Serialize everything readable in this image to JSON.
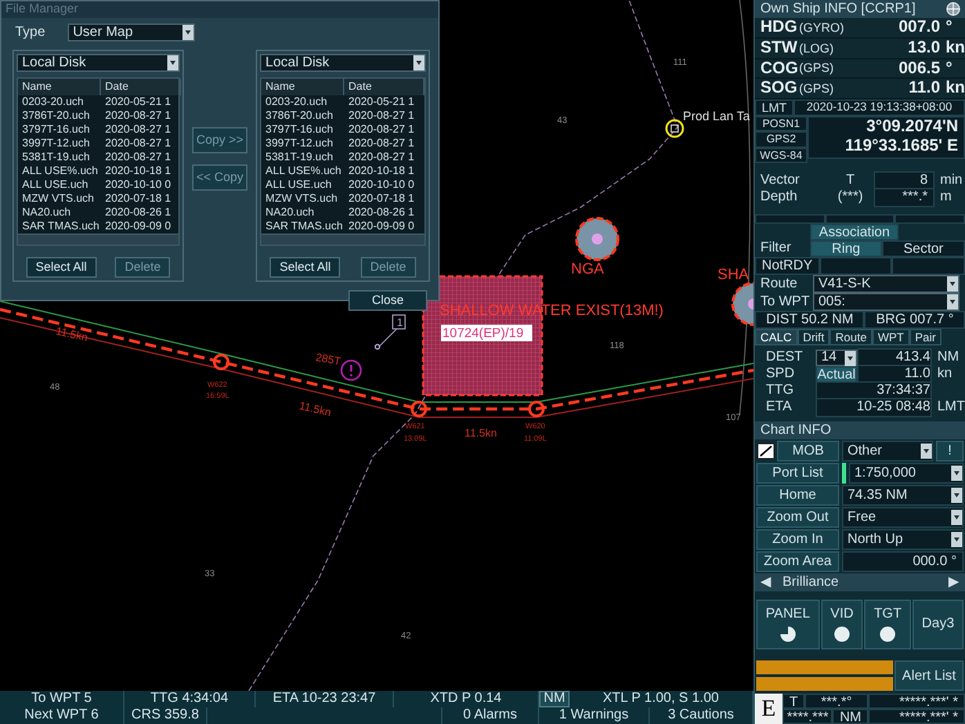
{
  "file_manager": {
    "title": "File Manager",
    "type_label": "Type",
    "type_value": "User Map",
    "panes": [
      {
        "source": "Local Disk",
        "columns": [
          "Name",
          "Date"
        ],
        "rows": [
          {
            "name": "0203-20.uch",
            "date": "2020-05-21 1"
          },
          {
            "name": "3786T-20.uch",
            "date": "2020-08-27 1"
          },
          {
            "name": "3797T-16.uch",
            "date": "2020-08-27 1"
          },
          {
            "name": "3997T-12.uch",
            "date": "2020-08-27 1"
          },
          {
            "name": "5381T-19.uch",
            "date": "2020-08-27 1"
          },
          {
            "name": "ALL USE%.uch",
            "date": "2020-10-18 1"
          },
          {
            "name": "ALL USE.uch",
            "date": "2020-10-10 0"
          },
          {
            "name": "MZW VTS.uch",
            "date": "2020-07-18 1"
          },
          {
            "name": "NA20.uch",
            "date": "2020-08-26 1"
          },
          {
            "name": "SAR TMAS.uch",
            "date": "2020-09-09 0"
          }
        ],
        "buttons": [
          {
            "label": "Select All",
            "disabled": false
          },
          {
            "label": "Delete",
            "disabled": true
          }
        ]
      },
      {
        "source": "Local Disk",
        "columns": [
          "Name",
          "Date"
        ],
        "rows": [
          {
            "name": "0203-20.uch",
            "date": "2020-05-21 1"
          },
          {
            "name": "3786T-20.uch",
            "date": "2020-08-27 1"
          },
          {
            "name": "3797T-16.uch",
            "date": "2020-08-27 1"
          },
          {
            "name": "3997T-12.uch",
            "date": "2020-08-27 1"
          },
          {
            "name": "5381T-19.uch",
            "date": "2020-08-27 1"
          },
          {
            "name": "ALL USE%.uch",
            "date": "2020-10-18 1"
          },
          {
            "name": "ALL USE.uch",
            "date": "2020-10-10 0"
          },
          {
            "name": "MZW VTS.uch",
            "date": "2020-07-18 1"
          },
          {
            "name": "NA20.uch",
            "date": "2020-08-26 1"
          },
          {
            "name": "SAR TMAS.uch",
            "date": "2020-09-09 0"
          }
        ],
        "buttons": [
          {
            "label": "Select All",
            "disabled": false
          },
          {
            "label": "Delete",
            "disabled": true
          }
        ]
      }
    ],
    "copy_buttons": [
      {
        "label": "Copy >>",
        "disabled": true
      },
      {
        "label": "<< Copy",
        "disabled": true
      }
    ],
    "close": "Close"
  },
  "chart": {
    "labels": [
      {
        "text": "Prod Lan Ta",
        "kind": "name"
      },
      {
        "text": "NGA",
        "kind": "warning"
      },
      {
        "text": "SHA",
        "kind": "warning"
      },
      {
        "text": "SHALLOW WATER EXIST(13M!)",
        "kind": "warning"
      },
      {
        "text": "10724(EP)/19",
        "kind": "tag"
      },
      {
        "text": "11.5kn",
        "kind": "speed"
      },
      {
        "text": "11.5kn",
        "kind": "speed"
      },
      {
        "text": "11.5kn",
        "kind": "speed"
      },
      {
        "text": "285T",
        "kind": "speed"
      },
      {
        "text": "W622",
        "kind": "waypoint"
      },
      {
        "text": "16:59L",
        "kind": "waypoint"
      },
      {
        "text": "W621",
        "kind": "waypoint"
      },
      {
        "text": "13:09L",
        "kind": "waypoint"
      },
      {
        "text": "W620",
        "kind": "waypoint"
      },
      {
        "text": "11:09L",
        "kind": "waypoint"
      },
      {
        "text": "1",
        "kind": "mark"
      },
      {
        "text": "43",
        "kind": "depth"
      },
      {
        "text": "111",
        "kind": "depth"
      },
      {
        "text": "118",
        "kind": "depth"
      },
      {
        "text": "107",
        "kind": "depth"
      },
      {
        "text": "48",
        "kind": "depth"
      },
      {
        "text": "33",
        "kind": "depth"
      },
      {
        "text": "42",
        "kind": "depth"
      }
    ]
  },
  "status_bar": {
    "to_wpt": "To WPT 5",
    "ttg": "TTG 4:34:04",
    "eta": "ETA 10-23 23:47",
    "xtd": "XTD P 0.14",
    "xtd_unit": "NM",
    "xtl": "XTL P 1.00, S 1.00",
    "next_wpt": "Next WPT 6",
    "crs": "CRS 359.8",
    "alarms": "0 Alarms",
    "warnings": "1 Warnings",
    "cautions": "3 Cautions"
  },
  "own_ship": {
    "title": "Own Ship INFO [CCRP1]",
    "readings": [
      {
        "name": "HDG",
        "source": "(GYRO)",
        "value": "007.0",
        "unit": "°"
      },
      {
        "name": "STW",
        "source": "(LOG)",
        "value": "13.0",
        "unit": "kn"
      },
      {
        "name": "COG",
        "source": "(GPS)",
        "value": "006.5",
        "unit": "°"
      },
      {
        "name": "SOG",
        "source": "(GPS)",
        "value": "11.0",
        "unit": "kn"
      }
    ],
    "lmt_label": "LMT",
    "lmt": "2020-10-23 19:13:38+08:00",
    "position": {
      "labels": [
        "POSN1",
        "GPS2",
        "WGS-84"
      ],
      "lat": "3°09.2074'N",
      "lon": "119°33.1685' E"
    },
    "vector": {
      "label": "Vector",
      "mode": "T",
      "value": "8",
      "unit": "min"
    },
    "depth": {
      "label": "Depth",
      "source": "(***)",
      "value": "***.*",
      "unit": "m"
    },
    "filter": {
      "label": "Filter",
      "options": [
        {
          "label": "Association",
          "selected": true
        },
        {
          "label": "Ring",
          "selected": true
        },
        {
          "label": "Sector",
          "selected": false
        }
      ],
      "status": "NotRDY"
    }
  },
  "route": {
    "route_label": "Route",
    "route": "V41-S-K",
    "wpt_label": "To WPT",
    "wpt": "005:",
    "dist": "DIST 50.2 NM",
    "brg": "BRG 007.7 °",
    "tabs": [
      {
        "label": "CALC",
        "selected": true
      },
      {
        "label": "Drift",
        "selected": false
      },
      {
        "label": "Route",
        "selected": false
      },
      {
        "label": "WPT",
        "selected": false
      },
      {
        "label": "Pair",
        "selected": false
      }
    ],
    "calc": [
      {
        "label": "DEST",
        "kind": "select",
        "control": "14",
        "value": "413.4",
        "unit": "NM"
      },
      {
        "label": "SPD",
        "kind": "button",
        "control": "Actual",
        "value": "11.0",
        "unit": "kn"
      },
      {
        "label": "TTG",
        "kind": "plain",
        "value": "37:34:37"
      },
      {
        "label": "ETA",
        "kind": "plain",
        "value": "10-25 08:48",
        "unit": "LMT"
      }
    ]
  },
  "chart_info": {
    "title": "Chart INFO",
    "mob": "MOB",
    "alert_mark": "!",
    "buttons": [
      "Port List",
      "Home",
      "Zoom Out",
      "Zoom In",
      "Zoom Area"
    ],
    "selects": [
      "Other",
      "1:750,000",
      "74.35 NM",
      "Free",
      "North Up"
    ],
    "rotation": "000.0 °",
    "brilliance": "Brilliance",
    "arrows": [
      "◀",
      "▶"
    ]
  },
  "display": [
    {
      "label": "PANEL",
      "kind": "pie"
    },
    {
      "label": "VID",
      "kind": "dot"
    },
    {
      "label": "TGT",
      "kind": "dot"
    },
    {
      "label": "Day3",
      "kind": "text"
    }
  ],
  "alert_list": "Alert List",
  "cursor": {
    "mode": "E",
    "bearing_label": "T",
    "bearing": "***.*°",
    "range": "****.***",
    "range_unit": "NM",
    "lat": "*****.***' *",
    "lon": "*****.***' *"
  }
}
